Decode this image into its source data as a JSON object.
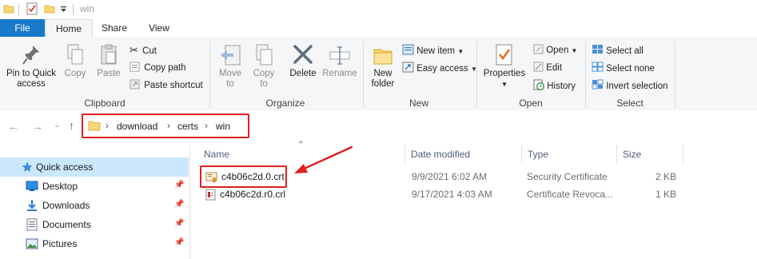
{
  "window": {
    "title": "win"
  },
  "tabs": {
    "file": "File",
    "home": "Home",
    "share": "Share",
    "view": "View"
  },
  "ribbon": {
    "clipboard": {
      "label": "Clipboard",
      "pin_line1": "Pin to Quick",
      "pin_line2": "access",
      "copy": "Copy",
      "paste": "Paste",
      "cut": "Cut",
      "copy_path": "Copy path",
      "paste_shortcut": "Paste shortcut"
    },
    "organize": {
      "label": "Organize",
      "move_line1": "Move",
      "move_line2": "to",
      "copy_line1": "Copy",
      "copy_line2": "to",
      "delete": "Delete",
      "rename": "Rename"
    },
    "new": {
      "label": "New",
      "new_folder_line1": "New",
      "new_folder_line2": "folder",
      "new_item": "New item",
      "easy_access": "Easy access"
    },
    "open": {
      "label": "Open",
      "properties": "Properties",
      "open": "Open",
      "edit": "Edit",
      "history": "History"
    },
    "select": {
      "label": "Select",
      "select_all": "Select all",
      "select_none": "Select none",
      "invert_selection": "Invert selection"
    }
  },
  "address": {
    "crumbs": [
      "download",
      "certs",
      "win"
    ]
  },
  "nav": {
    "items": [
      {
        "label": "Quick access",
        "icon": "star-icon"
      },
      {
        "label": "Desktop",
        "icon": "desktop-icon"
      },
      {
        "label": "Downloads",
        "icon": "download-icon"
      },
      {
        "label": "Documents",
        "icon": "documents-icon"
      },
      {
        "label": "Pictures",
        "icon": "pictures-icon"
      }
    ]
  },
  "columns": {
    "name": "Name",
    "date": "Date modified",
    "type": "Type",
    "size": "Size"
  },
  "files": [
    {
      "name": "c4b06c2d.0.crt",
      "date": "9/9/2021 6:02 AM",
      "type": "Security Certificate",
      "size": "2 KB"
    },
    {
      "name": "c4b06c2d.r0.crl",
      "date": "9/17/2021 4:03 AM",
      "type": "Certificate Revoca...",
      "size": "1 KB"
    }
  ],
  "colors": {
    "file_tab": "#1979ca",
    "highlight": "#e01e1e",
    "selected_nav": "#cce8ff"
  }
}
